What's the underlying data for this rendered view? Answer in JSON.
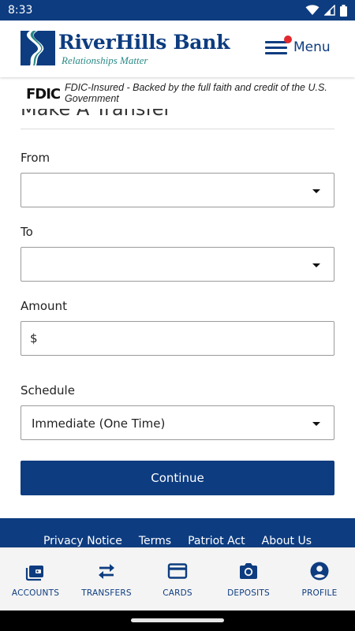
{
  "status_bar": {
    "time": "8:33",
    "icons": [
      "wifi-icon",
      "signal-icon",
      "battery-icon"
    ]
  },
  "header": {
    "brand_name": "RiverHills Bank",
    "tagline": "Relationships Matter",
    "menu_label": "Menu",
    "has_notification": true
  },
  "fdic": {
    "logo_text": "FDIC",
    "text": "FDIC-Insured - Backed by the full faith and credit of the U.S. Government"
  },
  "page": {
    "title": "Make A Transfer"
  },
  "form": {
    "from_label": "From",
    "from_value": "",
    "to_label": "To",
    "to_value": "",
    "amount_label": "Amount",
    "amount_prefix": "$",
    "amount_value": "",
    "schedule_label": "Schedule",
    "schedule_value": "Immediate (One Time)",
    "continue_label": "Continue"
  },
  "footer": {
    "links": [
      "Privacy Notice",
      "Terms",
      "Patriot Act",
      "About Us"
    ]
  },
  "bottom_nav": {
    "items": [
      {
        "label": "ACCOUNTS",
        "icon": "accounts-icon"
      },
      {
        "label": "TRANSFERS",
        "icon": "transfers-icon"
      },
      {
        "label": "CARDS",
        "icon": "cards-icon"
      },
      {
        "label": "DEPOSITS",
        "icon": "deposits-icon"
      },
      {
        "label": "PROFILE",
        "icon": "profile-icon"
      }
    ]
  },
  "colors": {
    "primary": "#0d3c80",
    "accent_teal": "#2a8a86",
    "notification": "#e2282d"
  }
}
